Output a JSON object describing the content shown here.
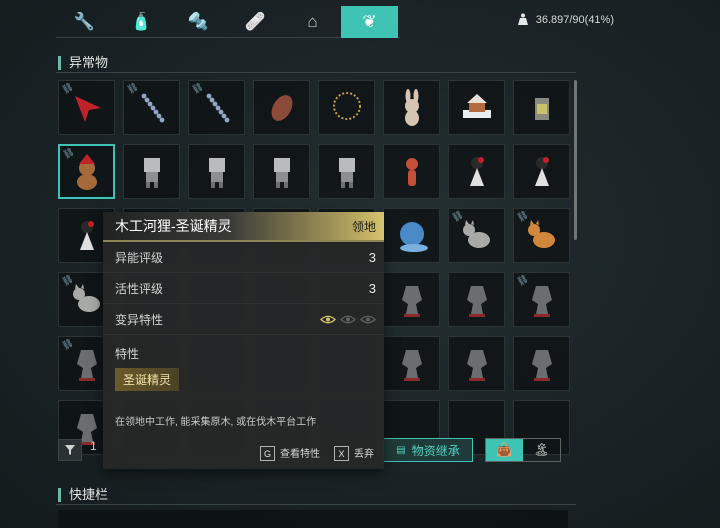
{
  "tabs": [
    {
      "icon": "wrench-icon",
      "glyph": "🔧",
      "active": false
    },
    {
      "icon": "bottle-icon",
      "glyph": "🧴",
      "active": false
    },
    {
      "icon": "bolt-icon",
      "glyph": "🔩",
      "active": false
    },
    {
      "icon": "first-aid-icon",
      "glyph": "🩹",
      "active": false
    },
    {
      "icon": "house-icon",
      "glyph": "⌂",
      "active": false
    },
    {
      "icon": "butterfly-icon",
      "glyph": "❦",
      "active": true
    }
  ],
  "weight": {
    "text": "36.897/90(41%)",
    "icon": "weight-icon"
  },
  "sections": {
    "anomalies": "异常物",
    "quickbar": "快捷栏"
  },
  "grid": {
    "rows": [
      [
        {
          "item": "red-arrow-icon",
          "linked": true,
          "color": "#c0222c"
        },
        {
          "item": "bead-chain-icon",
          "linked": true,
          "color": "#8fa7c4"
        },
        {
          "item": "bead-chain-icon",
          "linked": true,
          "color": "#8fa7c4"
        },
        {
          "item": "amulet-leaf-icon",
          "linked": false,
          "color": "#8c4a3a"
        },
        {
          "item": "necklace-icon",
          "linked": false,
          "color": "#c79a4a"
        },
        {
          "item": "bunny-plush-icon",
          "linked": false,
          "color": "#d6c4b4"
        },
        {
          "item": "gingerbread-house-icon",
          "linked": false,
          "color": "#b46a3a"
        },
        {
          "item": "lighter-icon",
          "linked": false,
          "color": "#c9c26a"
        }
      ],
      [
        {
          "item": "raccoon-santa-icon",
          "linked": true,
          "color": "#a66a3a",
          "selected": true
        },
        {
          "item": "box-robot-icon",
          "linked": false,
          "color": "#b8bcbc"
        },
        {
          "item": "box-robot-icon",
          "linked": false,
          "color": "#b8bcbc"
        },
        {
          "item": "box-robot-icon",
          "linked": false,
          "color": "#b8bcbc"
        },
        {
          "item": "box-robot-icon",
          "linked": false,
          "color": "#b8bcbc"
        },
        {
          "item": "fox-figure-icon",
          "linked": false,
          "color": "#c4503a"
        },
        {
          "item": "doll-figure-icon",
          "linked": false,
          "color": "#e0e0e0"
        },
        {
          "item": "doll-figure-icon",
          "linked": false,
          "color": "#e0e0e0"
        }
      ],
      [
        {
          "item": "doll-figure-icon",
          "linked": false,
          "color": "#e0e0e0"
        },
        null,
        null,
        null,
        null,
        {
          "item": "blue-snail-icon",
          "linked": false,
          "color": "#4a8ac9"
        },
        {
          "item": "gray-cat-icon",
          "linked": true,
          "color": "#a8aaa8"
        },
        {
          "item": "orange-cat-icon",
          "linked": true,
          "color": "#d2883a"
        }
      ],
      [
        {
          "item": "gray-cat-icon",
          "linked": true,
          "color": "#a8aaa8"
        },
        null,
        null,
        null,
        null,
        {
          "item": "dark-creature-icon",
          "linked": false,
          "color": "#6a6e70"
        },
        {
          "item": "dark-creature-icon",
          "linked": false,
          "color": "#6a6e70"
        },
        {
          "item": "dark-creature-icon",
          "linked": true,
          "color": "#6a6e70"
        }
      ],
      [
        {
          "item": "dark-creature-icon",
          "linked": true,
          "color": "#6a6e70"
        },
        null,
        null,
        null,
        null,
        {
          "item": "dark-creature-icon",
          "linked": false,
          "color": "#6a6e70"
        },
        {
          "item": "dark-creature-icon",
          "linked": false,
          "color": "#6a6e70"
        },
        {
          "item": "dark-creature-icon",
          "linked": false,
          "color": "#6a6e70"
        }
      ],
      [
        {
          "item": "dark-creature-icon",
          "linked": false,
          "color": "#6a6e70"
        },
        null,
        null,
        null,
        null,
        null,
        null,
        null
      ]
    ]
  },
  "toolbar": {
    "filter_icon": "filter-icon",
    "sort_glyph": "1",
    "inherit_label": "物资继承",
    "toggle": [
      {
        "icon": "bag-icon",
        "glyph": "👜",
        "active": true
      },
      {
        "icon": "island-icon",
        "glyph": "🏝",
        "active": false
      }
    ]
  },
  "tooltip": {
    "title": "木工河狸-圣诞精灵",
    "tag": "领地",
    "rows": [
      {
        "label": "异能评级",
        "value": "3"
      },
      {
        "label": "活性评级",
        "value": "3"
      },
      {
        "label": "变异特性",
        "value": ""
      }
    ],
    "mutation_eyes": [
      true,
      false,
      false
    ],
    "traits_label": "特性",
    "trait": "圣诞精灵",
    "description": "在领地中工作, 能采集原木, 或在伐木平台工作",
    "actions": [
      {
        "key": "G",
        "label": "查看特性"
      },
      {
        "key": "X",
        "label": "丢弃"
      }
    ]
  },
  "colors": {
    "accent": "#3ec3b5",
    "gold": "#d7c46d"
  }
}
